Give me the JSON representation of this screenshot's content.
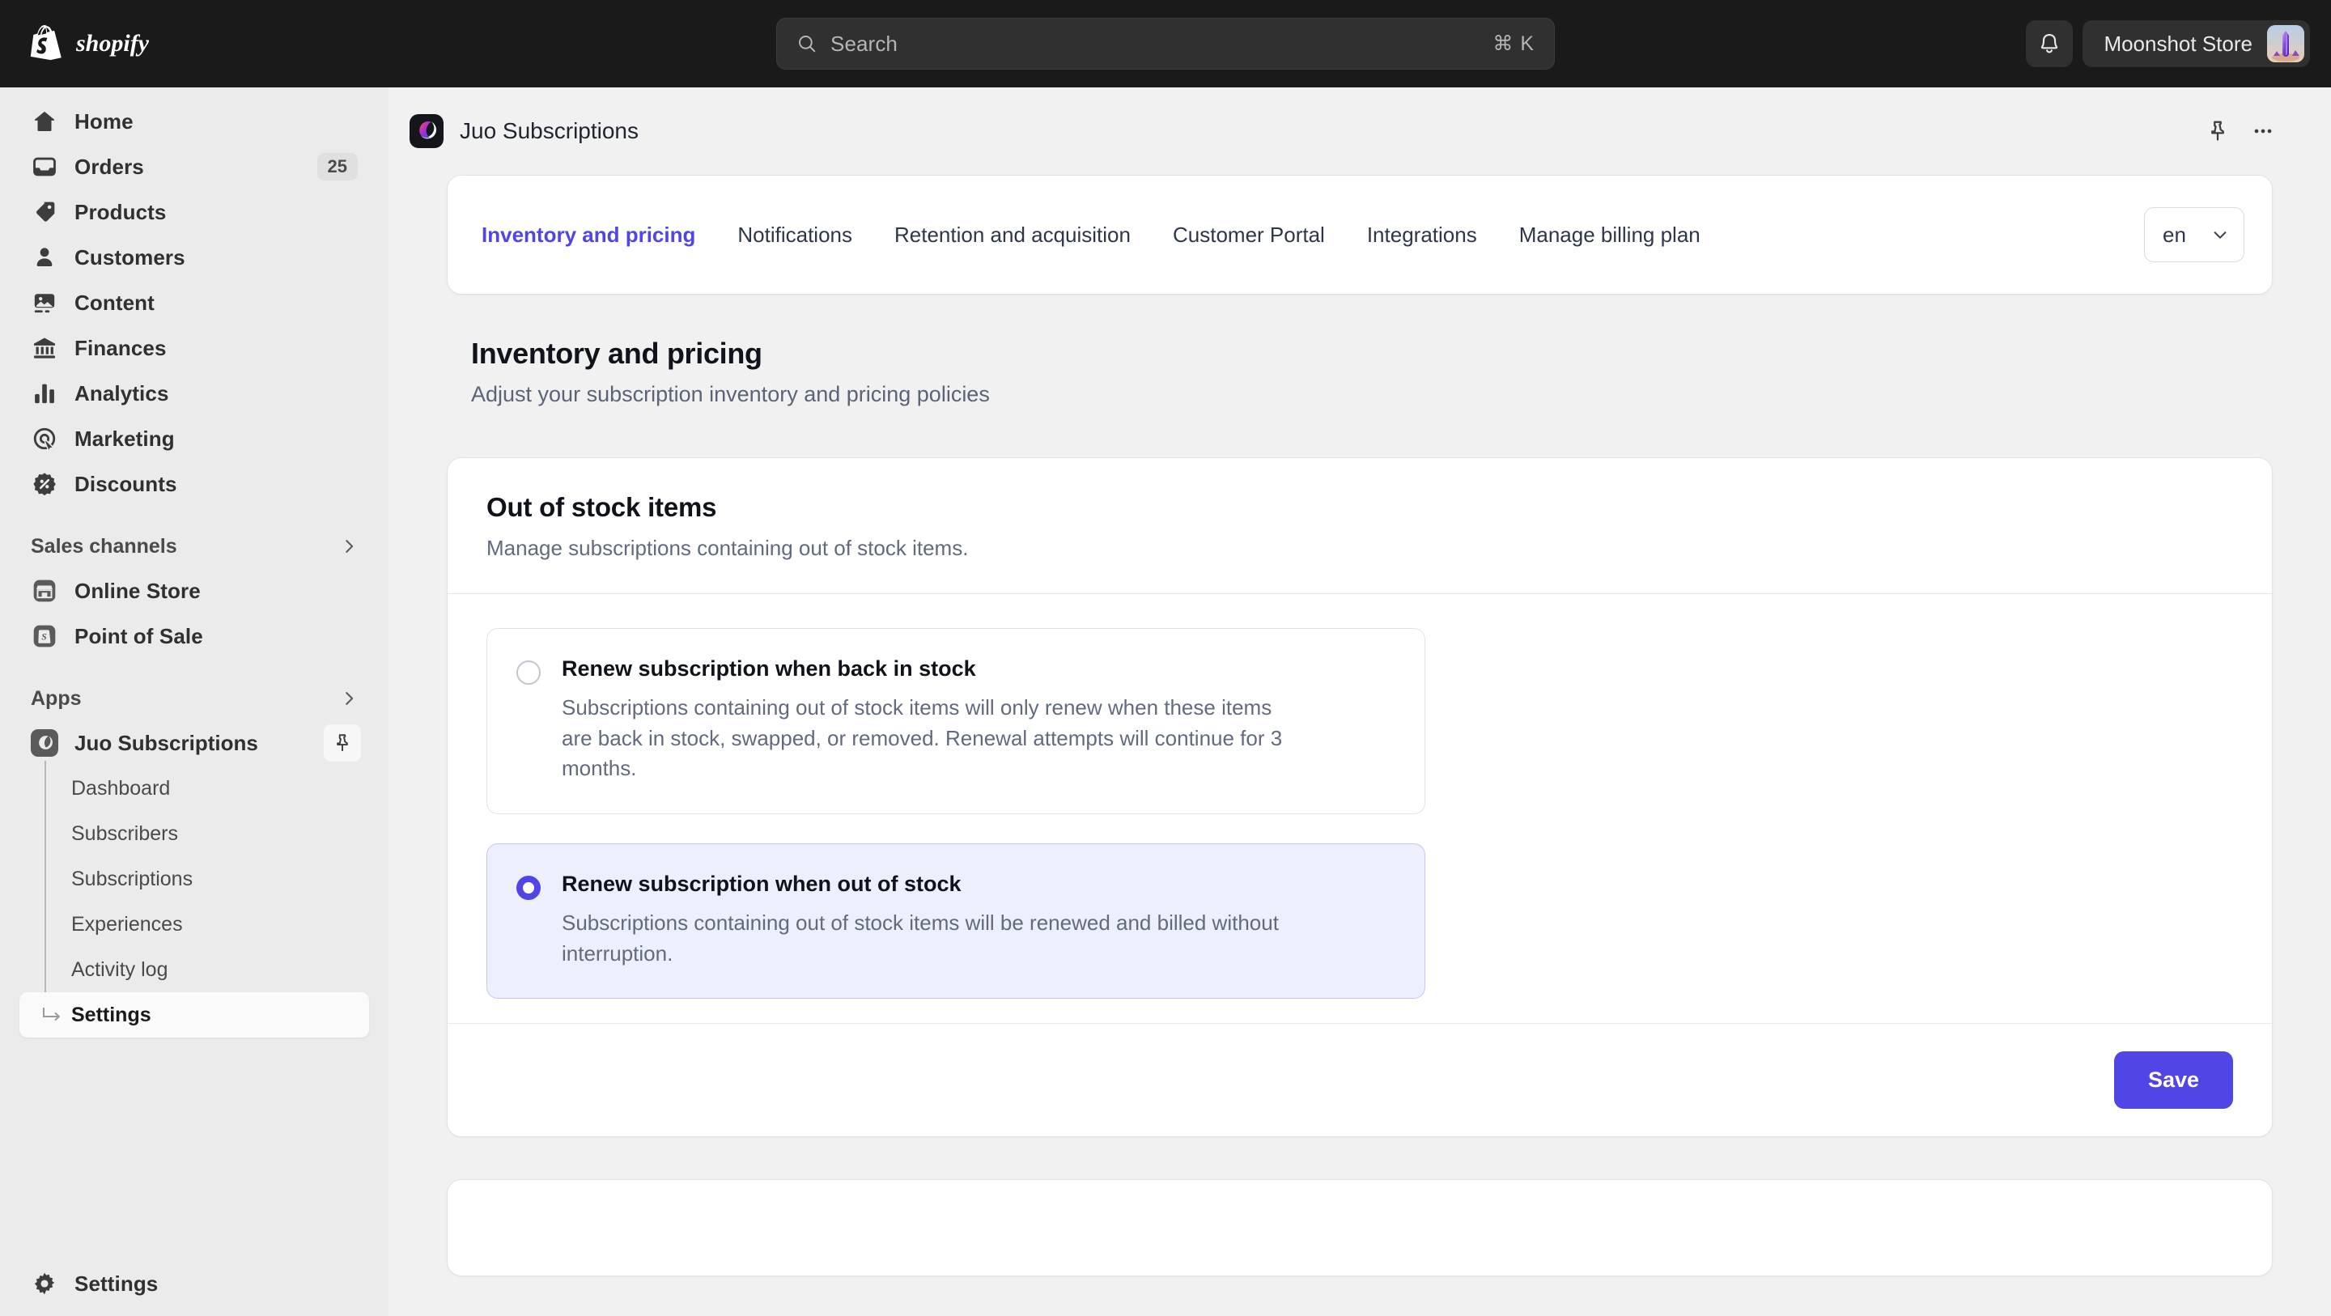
{
  "topbar": {
    "brand_name": "shopify",
    "search": {
      "placeholder": "Search",
      "shortcut": "⌘ K"
    },
    "notifications_label": "Notifications",
    "store_name": "Moonshot Store"
  },
  "sidebar": {
    "items": [
      {
        "label": "Home",
        "icon": "home-icon",
        "badge": ""
      },
      {
        "label": "Orders",
        "icon": "orders-icon",
        "badge": "25"
      },
      {
        "label": "Products",
        "icon": "products-icon",
        "badge": ""
      },
      {
        "label": "Customers",
        "icon": "customers-icon",
        "badge": ""
      },
      {
        "label": "Content",
        "icon": "content-icon",
        "badge": ""
      },
      {
        "label": "Finances",
        "icon": "finances-icon",
        "badge": ""
      },
      {
        "label": "Analytics",
        "icon": "analytics-icon",
        "badge": ""
      },
      {
        "label": "Marketing",
        "icon": "marketing-icon",
        "badge": ""
      },
      {
        "label": "Discounts",
        "icon": "discounts-icon",
        "badge": ""
      }
    ],
    "sales_channels": {
      "title": "Sales channels",
      "items": [
        {
          "label": "Online Store",
          "icon": "online-store-icon"
        },
        {
          "label": "Point of Sale",
          "icon": "point-of-sale-icon"
        }
      ]
    },
    "apps": {
      "title": "Apps",
      "app_name": "Juo Subscriptions",
      "pin_label": "Pin app",
      "sub_items": [
        {
          "label": "Dashboard",
          "active": false
        },
        {
          "label": "Subscribers",
          "active": false
        },
        {
          "label": "Subscriptions",
          "active": false
        },
        {
          "label": "Experiences",
          "active": false
        },
        {
          "label": "Activity log",
          "active": false
        },
        {
          "label": "Settings",
          "active": true
        }
      ]
    },
    "footer": {
      "label": "Settings",
      "icon": "gear-icon"
    }
  },
  "app_header": {
    "title": "Juo Subscriptions",
    "pin_label": "Pin",
    "more_label": "More actions"
  },
  "tabs": {
    "items": [
      {
        "label": "Inventory and pricing",
        "active": true
      },
      {
        "label": "Notifications",
        "active": false
      },
      {
        "label": "Retention and acquisition",
        "active": false
      },
      {
        "label": "Customer Portal",
        "active": false
      },
      {
        "label": "Integrations",
        "active": false
      },
      {
        "label": "Manage billing plan",
        "active": false
      }
    ],
    "language": {
      "value": "en"
    }
  },
  "page": {
    "title": "Inventory and pricing",
    "subtitle": "Adjust your subscription inventory and pricing policies"
  },
  "panel": {
    "title": "Out of stock items",
    "subtitle": "Manage subscriptions containing out of stock items.",
    "options": [
      {
        "title": "Renew subscription when back in stock",
        "description": "Subscriptions containing out of stock items will only renew when these items are back in stock, swapped, or removed. Renewal attempts will continue for 3 months.",
        "selected": false
      },
      {
        "title": "Renew subscription when out of stock",
        "description": "Subscriptions containing out of stock items will be renewed and billed without interruption.",
        "selected": true
      }
    ],
    "save_label": "Save"
  },
  "colors": {
    "accent": "#4f46e5",
    "topbar_bg": "#1a1a1a",
    "sidebar_bg": "#ebebeb",
    "main_bg": "#f1f1f1",
    "selected_option_bg": "#eeeffc"
  }
}
